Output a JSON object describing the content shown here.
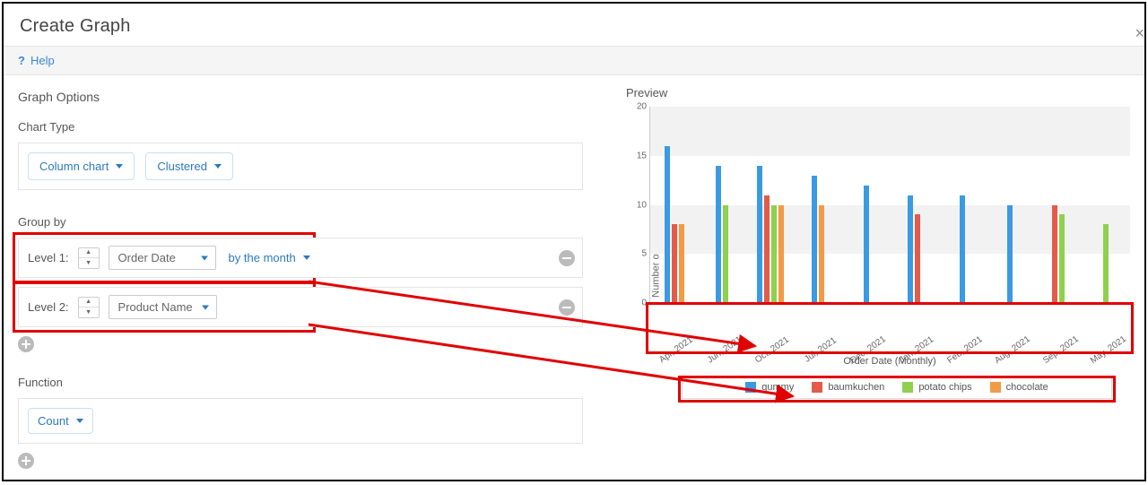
{
  "title": "Create Graph",
  "help_label": "Help",
  "sections": {
    "graph_options": "Graph Options",
    "chart_type": "Chart Type",
    "group_by": "Group by",
    "function": "Function",
    "preview": "Preview"
  },
  "chart_type": {
    "type_label": "Column chart",
    "mode_label": "Clustered"
  },
  "group_by": {
    "levels": [
      {
        "label": "Level 1:",
        "field": "Order Date",
        "granularity": "by the month"
      },
      {
        "label": "Level 2:",
        "field": "Product Name",
        "granularity": null
      }
    ]
  },
  "function": {
    "selected": "Count"
  },
  "chart_data": {
    "type": "bar",
    "title": "",
    "xlabel": "Order Date (Monthly)",
    "ylabel": "Number of Records",
    "ylim": [
      0,
      20
    ],
    "y_ticks": [
      0,
      5,
      10,
      15,
      20
    ],
    "categories": [
      "Apr, 2021",
      "Jun, 2021",
      "Oct, 2021",
      "Jul, 2021",
      "Dec, 2021",
      "Jan, 2021",
      "Feb, 2021",
      "Aug, 2021",
      "Sep, 2021",
      "May, 2021"
    ],
    "series": [
      {
        "name": "gummy",
        "color": "#3b9ae1",
        "values": [
          16,
          14,
          14,
          13,
          12,
          11,
          11,
          10,
          null,
          null
        ]
      },
      {
        "name": "baumkuchen",
        "color": "#e25b4b",
        "values": [
          8,
          null,
          11,
          null,
          null,
          9,
          null,
          null,
          10,
          null
        ]
      },
      {
        "name": "potato chips",
        "color": "#8fd14f",
        "values": [
          null,
          10,
          10,
          null,
          null,
          null,
          null,
          null,
          9,
          8
        ]
      },
      {
        "name": "chocolate",
        "color": "#f19b46",
        "values": [
          8,
          null,
          10,
          10,
          null,
          null,
          null,
          null,
          null,
          null
        ]
      }
    ]
  },
  "colors": {
    "accent": "#2b7ac0",
    "highlight": "#e10000"
  }
}
